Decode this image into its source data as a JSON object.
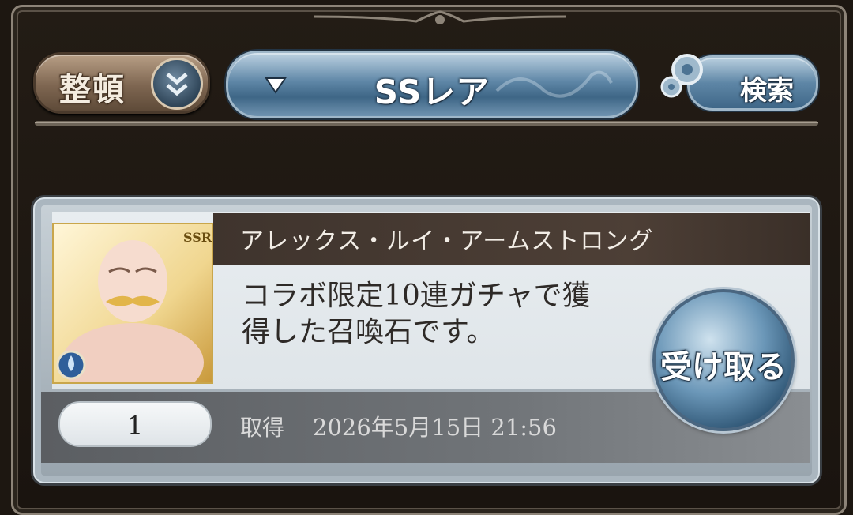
{
  "toolbar": {
    "sort_label": "整頓",
    "filter_label": "SSレア",
    "search_label": "検索"
  },
  "item": {
    "name": "アレックス・ルイ・アームストロング",
    "rarity": "SSR",
    "description_line1": "コラボ限定10連ガチャで獲",
    "description_line2": "得した召喚石です。",
    "count": "1",
    "acquired_label": "取得",
    "acquired_datetime": "2026年5月15日 21:56",
    "receive_label": "受け取る"
  },
  "colors": {
    "filter_blue": "#5f87a7",
    "sort_brown": "#7e6651",
    "name_bar": "#3f342d",
    "frame_gold": "#c9a64b"
  }
}
